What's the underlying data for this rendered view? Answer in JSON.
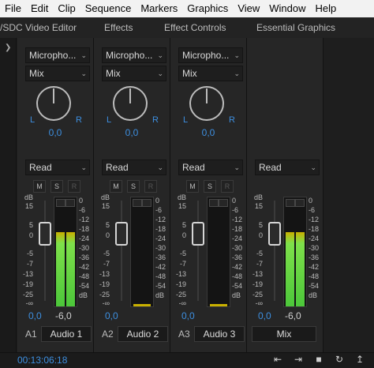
{
  "menu": [
    "File",
    "Edit",
    "Clip",
    "Sequence",
    "Markers",
    "Graphics",
    "View",
    "Window",
    "Help"
  ],
  "tabs": [
    "/SDC Video Editor",
    "Effects",
    "Effect Controls",
    "Essential Graphics"
  ],
  "scale_left": [
    "dB",
    "15",
    "5",
    "0",
    "-5",
    "-7",
    "-13",
    "-19",
    "-25",
    "-∞"
  ],
  "scale_right": [
    "0",
    "-6",
    "-12",
    "-18",
    "-24",
    "-30",
    "-36",
    "-42",
    "-48",
    "-54",
    "dB"
  ],
  "msr": [
    "M",
    "S",
    "R"
  ],
  "knob_labels": {
    "l": "L",
    "r": "R"
  },
  "strips": [
    {
      "input": "Micropho...",
      "mode": "Mix",
      "pan": "0,0",
      "read": "Read",
      "vol": "0,0",
      "peak": "-6,0",
      "id": "A1",
      "name": "Audio 1",
      "level": 0.78
    },
    {
      "input": "Micropho...",
      "mode": "Mix",
      "pan": "0,0",
      "read": "Read",
      "vol": "0,0",
      "peak": "",
      "id": "A2",
      "name": "Audio 2",
      "level": 0
    },
    {
      "input": "Micropho...",
      "mode": "Mix",
      "pan": "0,0",
      "read": "Read",
      "vol": "0,0",
      "peak": "",
      "id": "A3",
      "name": "Audio 3",
      "level": 0
    },
    {
      "read": "Read",
      "vol": "0,0",
      "peak": "-6,0",
      "id": "",
      "name": "Mix",
      "level": 0.78
    }
  ],
  "status": {
    "timecode": "00:13:06:18"
  },
  "transport_icons": [
    "step-back-icon",
    "step-forward-icon",
    "stop-icon",
    "loop-icon",
    "export-icon"
  ],
  "colors": {
    "accent": "#3d8fe0",
    "meter_green": "#4cc73a",
    "meter_yellow": "#c9b000"
  }
}
